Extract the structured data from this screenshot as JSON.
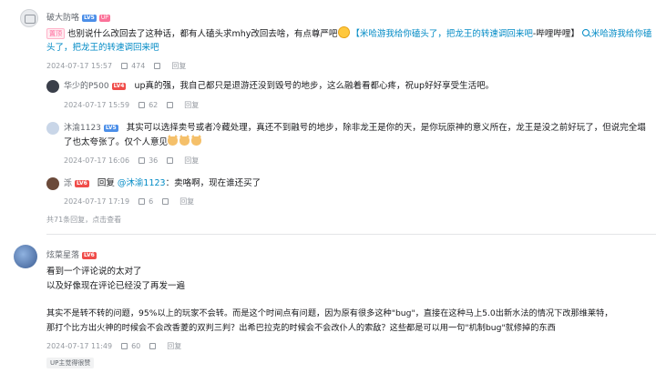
{
  "comments": [
    {
      "user": "破大防咯",
      "level": "LV5",
      "is_up": "UP",
      "hot_tag": "置顶",
      "text_part1": "也别说什么改回去了这种话，都有人磕头求mhy改回去啥，有点尊严吧",
      "link_text": "【米哈游我给你磕头了，把龙王的转速调回来吧",
      "link_suffix": "-哔哩哔哩】",
      "search_link": "米哈游我给你磕头了，把龙王的转速调回来吧",
      "time": "2024-07-17 15:57",
      "likes": "474",
      "reply": "回复",
      "replies": [
        {
          "user": "华少的P500",
          "level": "LV4",
          "text": "up真的强，我自己都只是退游还没到毁号的地步，这么融着看都心疼，祝up好好享受生活吧。",
          "time": "2024-07-17 15:59",
          "likes": "62",
          "reply": "回复"
        },
        {
          "user": "沐渝1123",
          "level": "LV5",
          "text": "其实可以选择卖号或者冷藏处理，真还不到融号的地步，除非龙王是你的天，是你玩原神的意义所在，龙王是没之前好玩了，但说完全塌了也太夸张了。仅个人意见",
          "time": "2024-07-17 16:06",
          "likes": "36",
          "reply": "回复"
        },
        {
          "user": "泺",
          "level": "LV6",
          "reply_prefix": "回复",
          "mention": "@沐渝1123",
          "text": "：卖咯啊，现在谁还买了",
          "time": "2024-07-17 17:19",
          "likes": "6",
          "reply": "回复"
        }
      ],
      "more_text": "共71条回复，",
      "more_link": "点击查看"
    },
    {
      "user": "炫菜星落",
      "level": "LV6",
      "line1": "看到一个评论说的太对了",
      "line2": "以及好像现在评论已经没了再发一遍",
      "line3": "其实不是转不转的问题，95%以上的玩家不会转。而是这个时间点有问题，因为原有很多这种\"bug\"，直接在这种马上5.0出新水法的情况下改那维莱特，",
      "line4": "那打个比方出火神的时候会不会改香菱的双判三判？出希巴拉克的时候会不会改仆人的索敌？这些都是可以用一句\"机制bug\"就修掉的东西",
      "time": "2024-07-17 11:49",
      "likes": "60",
      "reply": "回复",
      "badge": "UP主觉得很赞"
    }
  ],
  "colors": {
    "link": "#008ac5",
    "up_pink": "#fb7299",
    "meta_gray": "#9499a0"
  }
}
